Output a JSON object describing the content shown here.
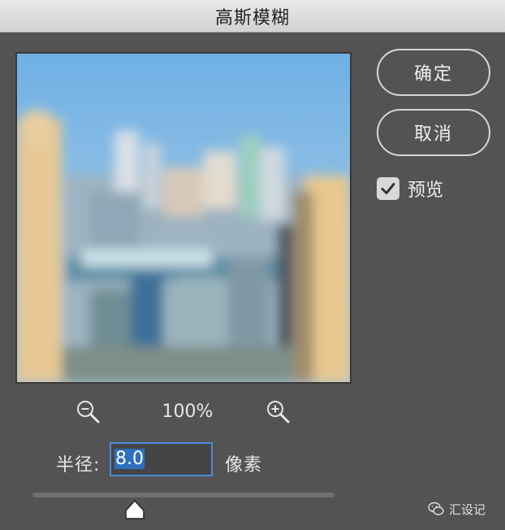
{
  "dialog": {
    "title": "高斯模糊"
  },
  "buttons": {
    "ok_label": "确定",
    "cancel_label": "取消"
  },
  "preview_option": {
    "label": "预览",
    "checked": true
  },
  "zoom": {
    "level": "100%",
    "zoom_out_icon": "zoom-out-icon",
    "zoom_in_icon": "zoom-in-icon"
  },
  "radius": {
    "label": "半径:",
    "value": "8.0",
    "unit": "像素",
    "slider_fraction": 0.34
  },
  "watermark": {
    "text": "汇设记",
    "icon": "wechat-icon"
  },
  "colors": {
    "background": "#535353",
    "titlebar": "#dcdcdc",
    "focus_border": "#4a8bd6",
    "selection": "#2e6fbf"
  }
}
